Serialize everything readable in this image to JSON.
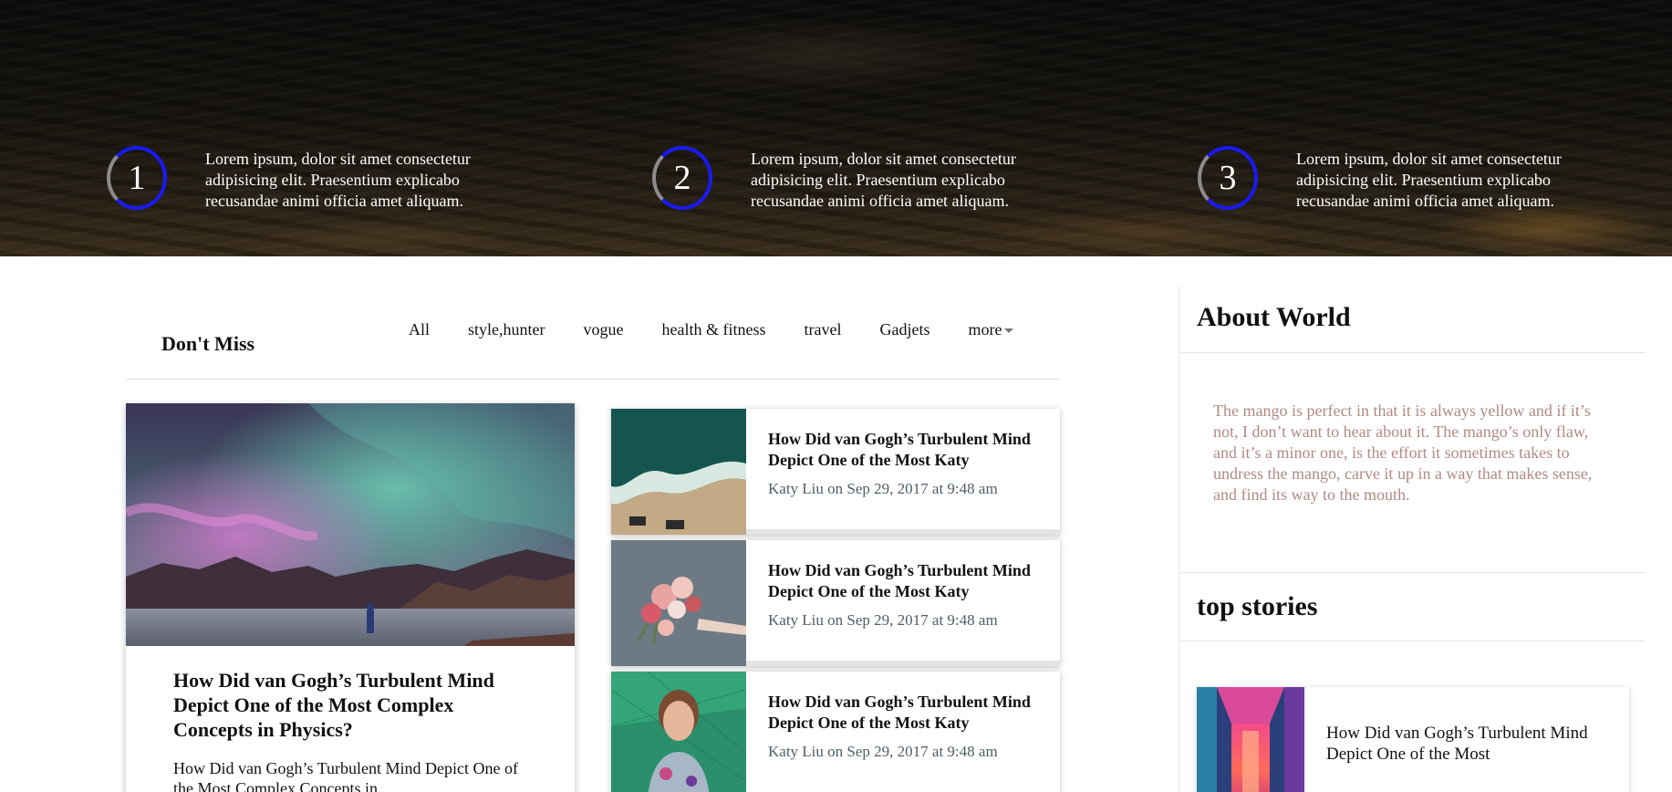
{
  "hero": {
    "steps": [
      {
        "number": "1",
        "text": "Lorem ipsum, dolor sit amet consectetur adipisicing elit. Praesentium explicabo recusandae animi officia amet aliquam."
      },
      {
        "number": "2",
        "text": "Lorem ipsum, dolor sit amet consectetur adipisicing elit. Praesentium explicabo recusandae animi officia amet aliquam."
      },
      {
        "number": "3",
        "text": "Lorem ipsum, dolor sit amet consectetur adipisicing elit. Praesentium explicabo recusandae animi officia amet aliquam."
      }
    ]
  },
  "dont_miss": {
    "title": "Don't Miss",
    "tabs": [
      "All",
      "style,hunter",
      "vogue",
      "health & fitness",
      "travel",
      "Gadjets",
      "more"
    ]
  },
  "featured": {
    "title": "How Did van Gogh’s Turbulent Mind Depict One of the Most Complex Concepts in Physics?",
    "excerpt": "How Did van Gogh’s Turbulent Mind Depict One of the Most Complex Concepts in"
  },
  "posts": [
    {
      "title": "How Did van Gogh’s Turbulent Mind Depict One of the Most Katy",
      "meta": "Katy Liu on Sep 29, 2017 at 9:48 am",
      "thumb": "aerial-beach-icon"
    },
    {
      "title": "How Did van Gogh’s Turbulent Mind Depict One of the Most Katy",
      "meta": "Katy Liu on Sep 29, 2017 at 9:48 am",
      "thumb": "flower-bouquet-icon"
    },
    {
      "title": "How Did van Gogh’s Turbulent Mind Depict One of the Most Katy",
      "meta": "Katy Liu on Sep 29, 2017 at 9:48 am",
      "thumb": "woman-portrait-icon"
    }
  ],
  "sidebar": {
    "about_title": "About World",
    "about_text": "The mango is perfect in that it is always yellow and if it’s not, I don’t want to hear about it. The mango’s only flaw, and it’s a minor one, is the effort it sometimes takes to undress the mango, carve it up in a way that makes sense, and find its way to the mouth.",
    "top_title": "top stories",
    "top_story": {
      "title": "How Did van Gogh’s Turbulent Mind Depict One of the Most"
    }
  },
  "colors": {
    "ring_accent": "#1a1af0",
    "ring_track": "#8c8c8c",
    "about_text": "#b08a86",
    "meta_text": "#4f5e66"
  }
}
